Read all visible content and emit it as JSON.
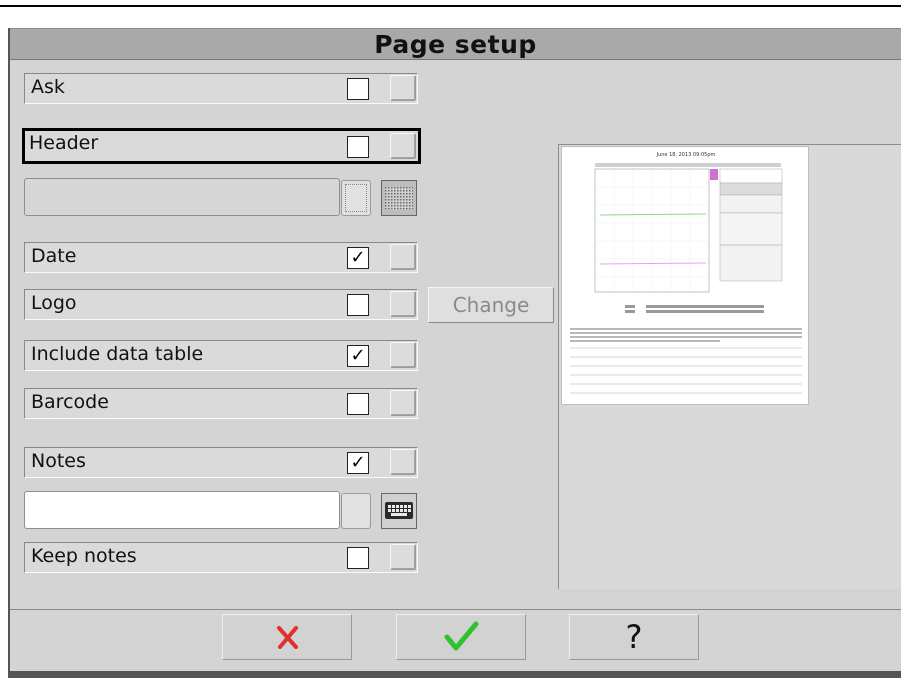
{
  "window": {
    "title": "Page setup"
  },
  "options": [
    {
      "key": "ask",
      "label": "Ask",
      "checked": false
    },
    {
      "key": "header",
      "label": "Header",
      "checked": false
    },
    {
      "key": "date",
      "label": "Date",
      "checked": true
    },
    {
      "key": "logo",
      "label": "Logo",
      "checked": false
    },
    {
      "key": "include_data_table",
      "label": "Include data table",
      "checked": true
    },
    {
      "key": "barcode",
      "label": "Barcode",
      "checked": false
    },
    {
      "key": "notes",
      "label": "Notes",
      "checked": true
    },
    {
      "key": "keep_notes",
      "label": "Keep notes",
      "checked": false
    }
  ],
  "check_mark": "✓",
  "header_field": {
    "value": ""
  },
  "notes_field": {
    "value": ""
  },
  "logo": {
    "change_label": "Change"
  },
  "footer": {
    "cancel_icon": "cancel-x-icon",
    "ok_icon": "green-check-icon",
    "help_label": "?"
  },
  "colors": {
    "cancel": "#e03030",
    "ok": "#2ec22e",
    "title_bar": "#a9a9a9",
    "preview_magenta": "#d070d0"
  },
  "preview": {
    "header_text": "June 18, 2013 09:05pm",
    "chart_lines": [
      "#8ad88a",
      "#e3a6e3"
    ]
  }
}
